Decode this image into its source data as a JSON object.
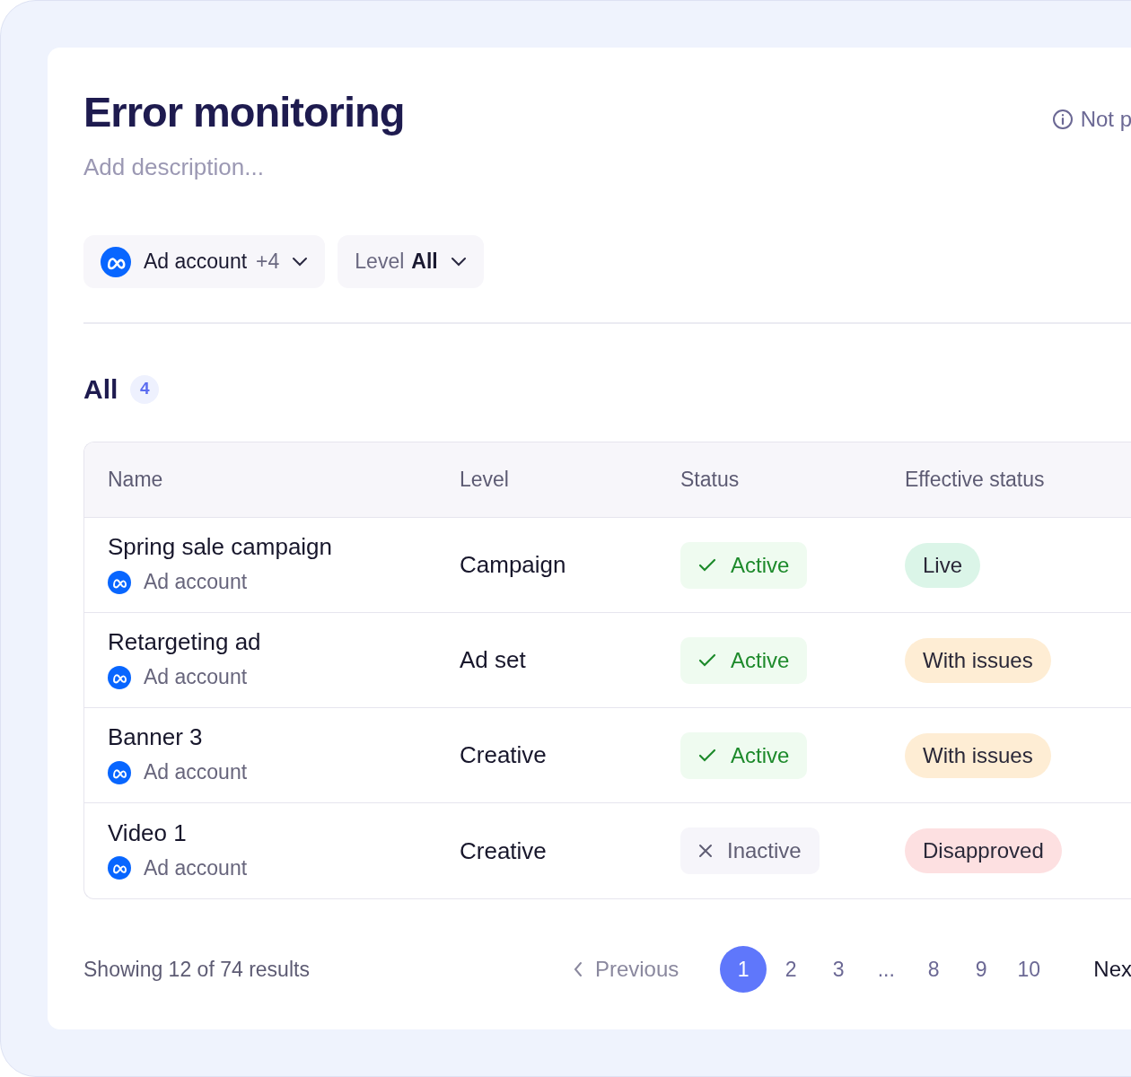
{
  "title": "Error monitoring",
  "description_placeholder": "Add description...",
  "notice": "Not p",
  "filters": [
    {
      "kind": "account",
      "label": "Ad account",
      "extra": "+4"
    },
    {
      "kind": "level",
      "label": "Level",
      "value": "All"
    }
  ],
  "section": {
    "label": "All",
    "count": "4"
  },
  "table": {
    "columns": [
      "Name",
      "Level",
      "Status",
      "Effective status"
    ],
    "rows": [
      {
        "name": "Spring sale campaign",
        "account": "Ad account",
        "level": "Campaign",
        "status": {
          "label": "Active",
          "active": true
        },
        "effective": {
          "label": "Live",
          "kind": "live"
        }
      },
      {
        "name": "Retargeting ad",
        "account": "Ad account",
        "level": "Ad set",
        "status": {
          "label": "Active",
          "active": true
        },
        "effective": {
          "label": "With issues",
          "kind": "warning"
        }
      },
      {
        "name": "Banner 3",
        "account": "Ad account",
        "level": "Creative",
        "status": {
          "label": "Active",
          "active": true
        },
        "effective": {
          "label": "With issues",
          "kind": "warning"
        }
      },
      {
        "name": "Video 1",
        "account": "Ad account",
        "level": "Creative",
        "status": {
          "label": "Inactive",
          "active": false
        },
        "effective": {
          "label": "Disapproved",
          "kind": "error"
        }
      }
    ]
  },
  "footer": {
    "summary": "Showing 12 of 74 results",
    "previous": "Previous",
    "next": "Nex",
    "pages": [
      {
        "label": "1",
        "selected": true
      },
      {
        "label": "2",
        "selected": false
      },
      {
        "label": "3",
        "selected": false
      },
      {
        "label": "...",
        "selected": false
      },
      {
        "label": "8",
        "selected": false
      },
      {
        "label": "9",
        "selected": false
      },
      {
        "label": "10",
        "selected": false
      }
    ]
  }
}
